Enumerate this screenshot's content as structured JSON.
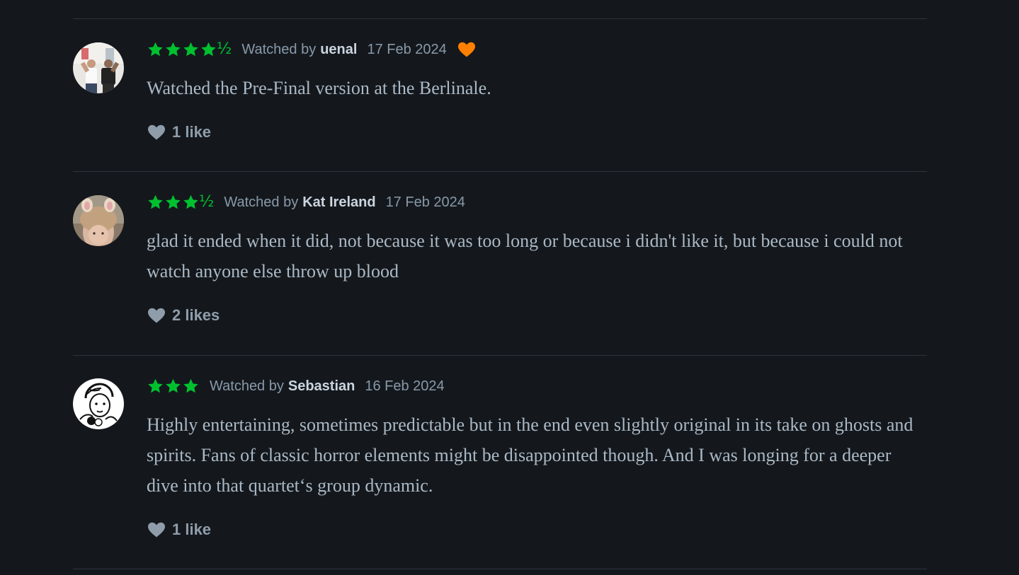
{
  "reviews": [
    {
      "rating_stars": 4.5,
      "watched_by_label": "Watched by",
      "username": "uenal",
      "date": "17 Feb 2024",
      "liked_by_reviewer": true,
      "text": "Watched the Pre-Final version at the Berlinale.",
      "likes": "1 like",
      "avatar_icon": "avatar-photo-two-people"
    },
    {
      "rating_stars": 3.5,
      "watched_by_label": "Watched by",
      "username": "Kat Ireland",
      "date": "17 Feb 2024",
      "liked_by_reviewer": false,
      "text": "glad it ended when it did, not because it was too long or because i didn't like it, but because i could not watch anyone else throw up blood",
      "likes": "2 likes",
      "avatar_icon": "avatar-photo-person"
    },
    {
      "rating_stars": 3,
      "watched_by_label": "Watched by",
      "username": "Sebastian",
      "date": "16 Feb 2024",
      "liked_by_reviewer": false,
      "text": "Highly entertaining, sometimes predictable but in the end even slightly original in its take on ghosts and spirits. Fans of classic horror elements might be disappointed though. And I was longing for a deeper dive into that quartet‘s group dynamic.",
      "likes": "1 like",
      "avatar_icon": "avatar-illustration"
    }
  ],
  "colors": {
    "background": "#14181c",
    "star_green": "#00c030",
    "liked_heart_orange": "#ff8000",
    "divider": "#2c3440",
    "text": "#abb9c6",
    "muted": "#8899aa",
    "username": "#cbd5df"
  }
}
